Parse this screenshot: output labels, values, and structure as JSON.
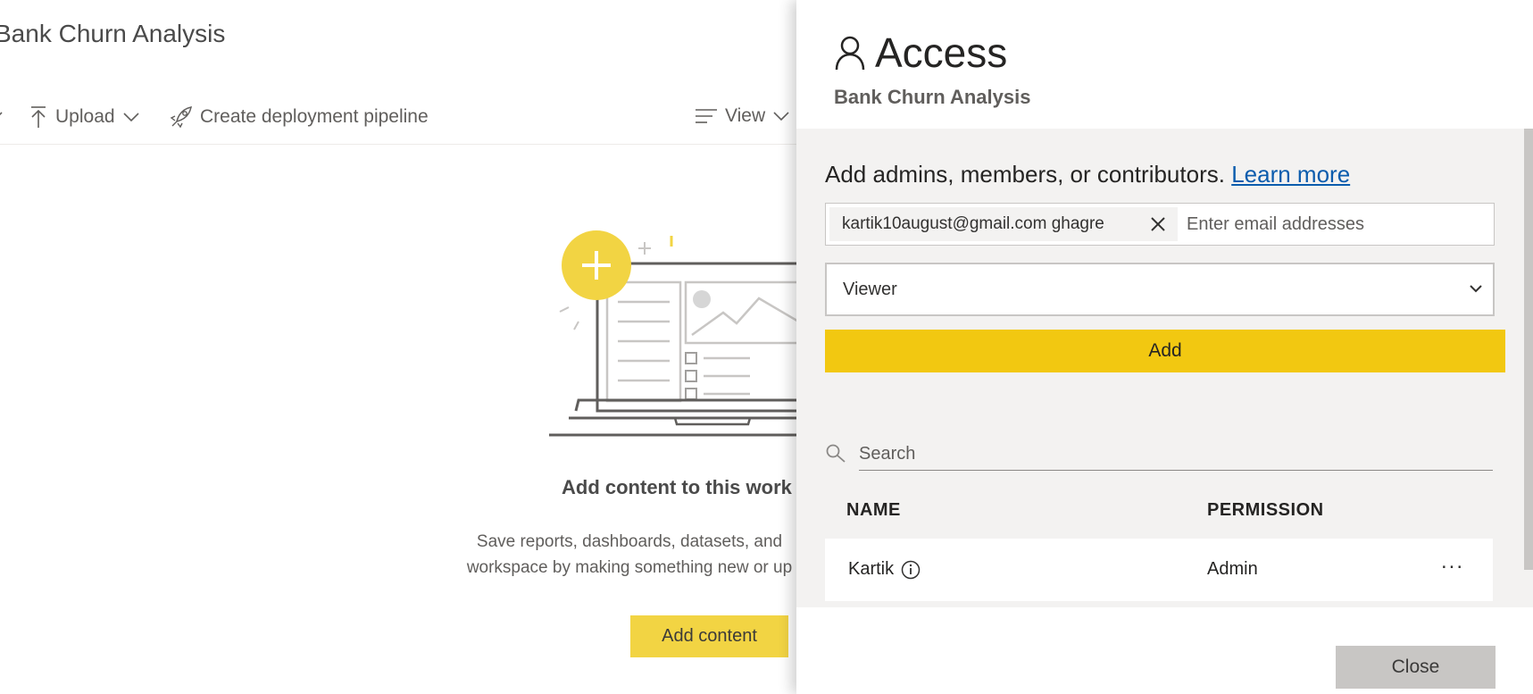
{
  "background": {
    "workspace_title": "Bank Churn Analysis",
    "toolbar": {
      "upload_label": "Upload",
      "pipeline_label": "Create deployment pipeline",
      "view_label": "View"
    },
    "empty_state": {
      "heading": "Add content to this work",
      "description_line1": "Save reports, dashboards, datasets, and",
      "description_line2": "workspace by making something new or up",
      "button_label": "Add content"
    }
  },
  "access_panel": {
    "title": "Access",
    "subtitle": "Bank Churn Analysis",
    "add_heading": "Add admins, members, or contributors.",
    "learn_more_label": "Learn more",
    "email_chip": "kartik10august@gmail.com ghagre",
    "email_placeholder": "Enter email addresses",
    "role_selected": "Viewer",
    "add_button_label": "Add",
    "search_placeholder": "Search",
    "columns": {
      "name": "NAME",
      "permission": "PERMISSION"
    },
    "users": [
      {
        "name": "Kartik",
        "permission": "Admin",
        "more": "..."
      }
    ],
    "close_button_label": "Close"
  },
  "colors": {
    "accent_yellow": "#F2C811",
    "add_content_yellow": "#F2D443",
    "link_blue": "#0B5CAD",
    "panel_body": "#F3F2F1"
  },
  "icons": [
    "upload-icon",
    "chevron-down-icon",
    "rocket-icon",
    "view-lines-icon",
    "person-icon",
    "close-icon",
    "search-icon",
    "info-icon",
    "more-icon"
  ]
}
